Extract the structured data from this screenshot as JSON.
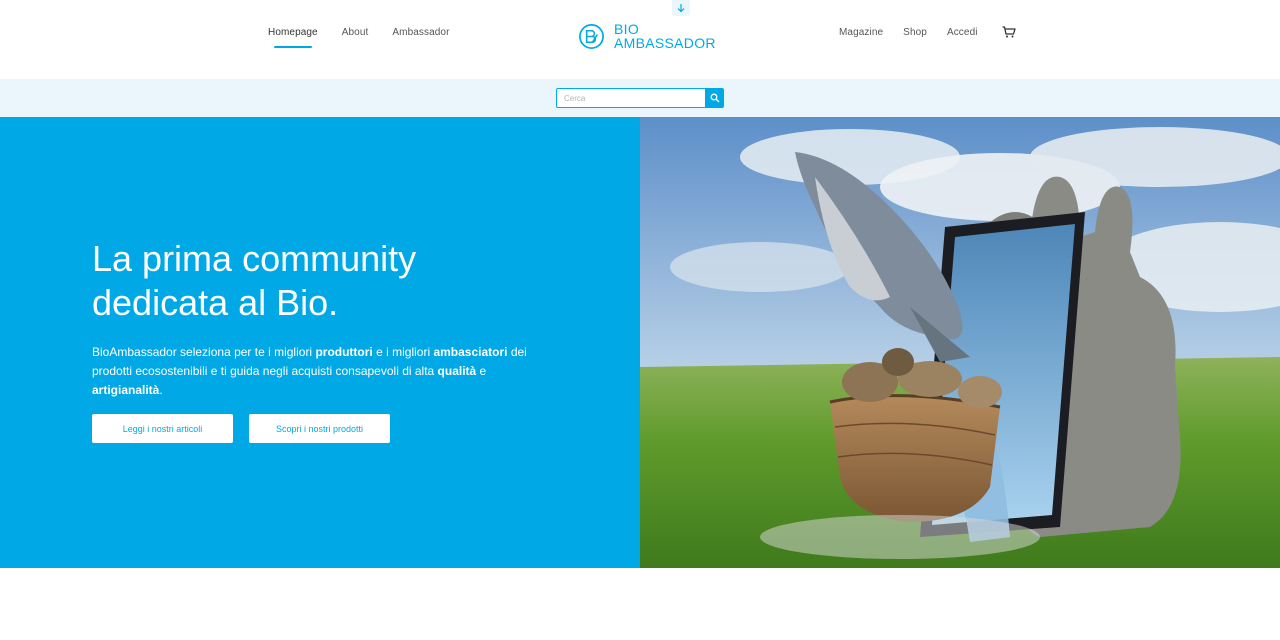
{
  "header": {
    "nav_left": [
      {
        "label": "Homepage",
        "active": true
      },
      {
        "label": "About"
      },
      {
        "label": "Ambassador"
      }
    ],
    "nav_right": [
      {
        "label": "Magazine"
      },
      {
        "label": "Shop"
      },
      {
        "label": "Accedi"
      }
    ],
    "logo": {
      "line1": "BIO",
      "line2": "AMBASSADOR"
    },
    "cart_icon": "cart-icon",
    "scroll_icon": "arrow-down-icon"
  },
  "search": {
    "placeholder": "Cerca",
    "icon": "search-icon"
  },
  "hero": {
    "title_line1": "La prima community",
    "title_line2": "dedicata al Bio.",
    "desc": {
      "t1": "BioAmbassador seleziona per te i migliori ",
      "b1": "produttori",
      "t2": " e i migliori ",
      "b2": "ambasciatori",
      "t3": " dei prodotti ecosostenibili e ti guida negli acquisti consapevoli di alta ",
      "b3": "qualità",
      "t4": " e ",
      "b4": "artigianalità",
      "t5": "."
    },
    "btn_articles": "Leggi i nostri articoli",
    "btn_products": "Scopri i nostri prodotti"
  },
  "colors": {
    "accent": "#00a9e6",
    "search_band": "#eaf6fc"
  }
}
